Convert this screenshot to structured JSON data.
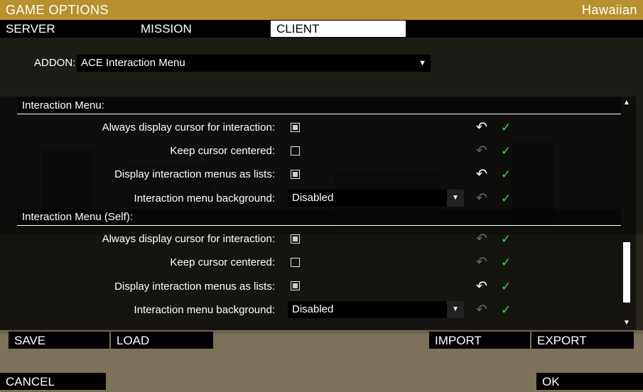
{
  "window": {
    "title": "GAME OPTIONS",
    "player_name": "Hawaiian"
  },
  "tabs": [
    {
      "label": "SERVER",
      "active": false
    },
    {
      "label": "MISSION",
      "active": false
    },
    {
      "label": "CLIENT",
      "active": true
    }
  ],
  "addon": {
    "label": "ADDON:",
    "selected": "ACE Interaction Menu"
  },
  "sections": [
    {
      "title": "Interaction Menu:",
      "rows": [
        {
          "label": "Always display cursor for interaction:",
          "control": "checkbox",
          "checked": true,
          "undo_enabled": true
        },
        {
          "label": "Keep cursor centered:",
          "control": "checkbox",
          "checked": false,
          "undo_enabled": false
        },
        {
          "label": "Display interaction menus as lists:",
          "control": "checkbox",
          "checked": true,
          "undo_enabled": true
        },
        {
          "label": "Interaction menu background:",
          "control": "dropdown",
          "value": "Disabled",
          "undo_enabled": false
        }
      ]
    },
    {
      "title": "Interaction Menu (Self):",
      "rows": [
        {
          "label": "Always display cursor for interaction:",
          "control": "checkbox",
          "checked": true,
          "undo_enabled": false
        },
        {
          "label": "Keep cursor centered:",
          "control": "checkbox",
          "checked": false,
          "undo_enabled": false
        },
        {
          "label": "Display interaction menus as lists:",
          "control": "checkbox",
          "checked": true,
          "undo_enabled": true
        },
        {
          "label": "Interaction menu background:",
          "control": "dropdown",
          "value": "Disabled",
          "undo_enabled": false
        }
      ]
    }
  ],
  "buttons": {
    "save": "SAVE",
    "load": "LOAD",
    "import": "IMPORT",
    "export": "EXPORT",
    "cancel": "CANCEL",
    "ok": "OK"
  },
  "icons": {
    "undo": "undo-arrow-icon",
    "confirm": "check-icon",
    "dropdown": "triangle-down-icon"
  },
  "colors": {
    "title_bar": "#b8912f",
    "check": "#2ee048",
    "active_tab": "#ffffff"
  }
}
